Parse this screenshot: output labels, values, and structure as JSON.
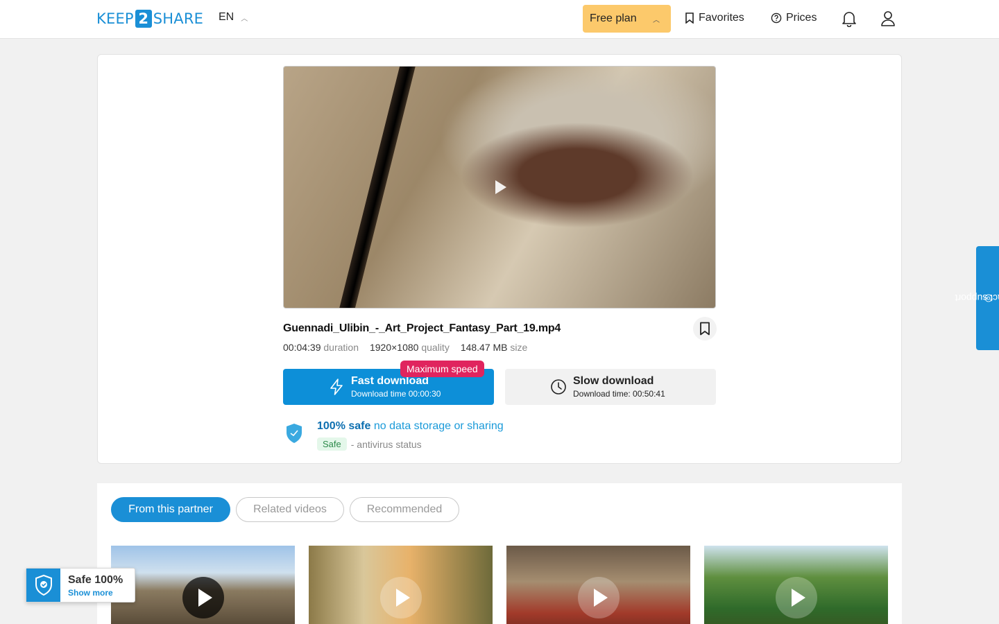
{
  "header": {
    "logo_left": "KEEP",
    "logo_num": "2",
    "logo_right": "SHARE",
    "lang": "EN",
    "plan": "Free plan",
    "favorites": "Favorites",
    "prices": "Prices"
  },
  "file": {
    "name": "Guennadi_Ulibin_-_Art_Project_Fantasy_Part_19.mp4",
    "duration": "00:04:39",
    "duration_label": "duration",
    "quality": "1920×1080",
    "quality_label": "quality",
    "size": "148.47 MB",
    "size_label": "size"
  },
  "download": {
    "badge": "Maximum speed",
    "fast_label": "Fast download",
    "fast_time": "Download time 00:00:30",
    "slow_label": "Slow download",
    "slow_time": "Download time: 00:50:41"
  },
  "safety": {
    "bold": "100% safe",
    "text": "no data storage or sharing",
    "tag": "Safe",
    "status": "- antivirus status"
  },
  "tabs": [
    "From this partner",
    "Related videos",
    "Recommended"
  ],
  "widget": {
    "title": "Safe 100%",
    "link": "Show more"
  },
  "support": "contact support",
  "colors": {
    "accent": "#1a8fd6",
    "plan": "#fcc96b",
    "badge": "#e0245e"
  }
}
